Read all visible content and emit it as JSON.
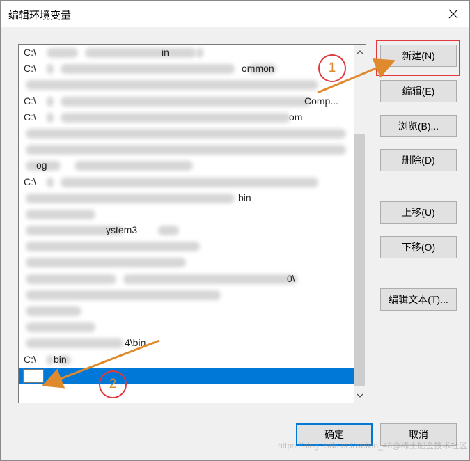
{
  "window": {
    "title": "编辑环境变量"
  },
  "list": {
    "rows": [
      {
        "text_left": "C:\\",
        "text_right": "in"
      },
      {
        "text_left": "C:\\",
        "text_right": "ommon"
      },
      {
        "text_left": "",
        "text_right": ""
      },
      {
        "text_left": "C:\\",
        "text_right": "Comp..."
      },
      {
        "text_left": "C:\\",
        "text_right": "om"
      },
      {
        "text_left": "",
        "text_right": ""
      },
      {
        "text_left": "",
        "text_right": ""
      },
      {
        "text_left": "",
        "text_right": "og"
      },
      {
        "text_left": "C:\\",
        "text_right": ""
      },
      {
        "text_left": "",
        "text_right": "bin"
      },
      {
        "text_left": "",
        "text_right": ""
      },
      {
        "text_left": "",
        "text_right": "ystem3"
      },
      {
        "text_left": "",
        "text_right": ""
      },
      {
        "text_left": "",
        "text_right": ""
      },
      {
        "text_left": "",
        "text_right": "0\\"
      },
      {
        "text_left": "",
        "text_right": ""
      },
      {
        "text_left": "",
        "text_right": ""
      },
      {
        "text_left": "",
        "text_right": ""
      },
      {
        "text_left": "",
        "text_right": "4\\bin"
      },
      {
        "text_left": "C:\\",
        "text_right": "bin"
      }
    ],
    "selected_value": ""
  },
  "buttons": {
    "new": "新建(N)",
    "edit": "编辑(E)",
    "browse": "浏览(B)...",
    "delete": "删除(D)",
    "move_up": "上移(U)",
    "move_down": "下移(O)",
    "edit_text": "编辑文本(T)...",
    "ok": "确定",
    "cancel": "取消"
  },
  "annotations": {
    "step1": "1",
    "step2": "2"
  },
  "watermark": "https://blog.csdn.net/weixin_43@稀土掘金技术社区",
  "colors": {
    "selection": "#0078d7",
    "annotation_red": "#e0393e",
    "annotation_orange": "#e08a2e"
  }
}
